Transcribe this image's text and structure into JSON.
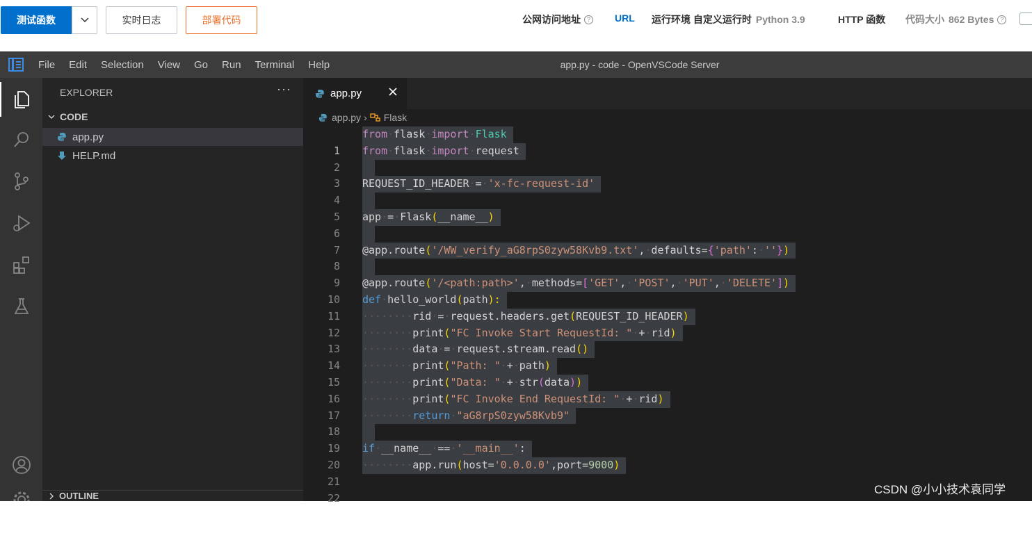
{
  "console": {
    "test_button": "测试函数",
    "log_button": "实时日志",
    "deploy_button": "部署代码",
    "public_url_label": "公网访问地址",
    "public_url_link": "URL",
    "runtime_label": "运行环境 自定义运行时",
    "runtime_value": "Python 3.9",
    "function_type": "HTTP 函数",
    "code_size_label": "代码大小",
    "code_size_value": "862 Bytes"
  },
  "vscode": {
    "window_title": "app.py - code - OpenVSCode Server",
    "menu": [
      "File",
      "Edit",
      "Selection",
      "View",
      "Go",
      "Run",
      "Terminal",
      "Help"
    ],
    "explorer": {
      "header": "EXPLORER",
      "more": "···",
      "folder": "CODE",
      "files": [
        "app.py",
        "HELP.md"
      ],
      "outline": "OUTLINE"
    },
    "tab_label": "app.py",
    "breadcrumb": {
      "file": "app.py",
      "symbol": "Flask"
    },
    "line_numbers": [
      "1",
      "2",
      "3",
      "4",
      "5",
      "6",
      "7",
      "8",
      "9",
      "10",
      "11",
      "12",
      "13",
      "14",
      "15",
      "16",
      "17",
      "18",
      "19",
      "20",
      "21",
      "22"
    ]
  },
  "code_text": {
    "l1": [
      "from",
      "flask",
      "import",
      "Flask"
    ],
    "l2": [
      "from",
      "flask",
      "import",
      "request"
    ],
    "l4": [
      "REQUEST_ID_HEADER",
      "=",
      "'x-fc-request-id'"
    ],
    "l6": [
      "app",
      "=",
      "Flask",
      "(",
      "__name__",
      ")"
    ],
    "l8": [
      "@app.route",
      "(",
      "'/WW_verify_aG8rpS0zyw58Kvb9.txt'",
      ",",
      "defaults",
      "=",
      "{",
      "'path'",
      ":",
      "''",
      "}",
      ")"
    ],
    "l10": [
      "@app.route",
      "(",
      "'/<path:path>'",
      ",",
      "methods",
      "=",
      "[",
      "'GET'",
      ",",
      "'POST'",
      ",",
      "'PUT'",
      ",",
      "'DELETE'",
      "]",
      ")"
    ],
    "l11": [
      "def",
      "hello_world",
      "(",
      "path",
      "):"
    ],
    "l12": [
      "rid",
      "=",
      "request",
      ".",
      "headers",
      ".",
      "get",
      "(",
      "REQUEST_ID_HEADER",
      ")"
    ],
    "l13": [
      "print",
      "(",
      "\"FC Invoke Start RequestId: \"",
      "+",
      "rid",
      ")"
    ],
    "l14": [
      "data",
      "=",
      "request",
      ".",
      "stream",
      ".",
      "read",
      "(",
      ")"
    ],
    "l15": [
      "print",
      "(",
      "\"Path: \"",
      "+",
      "path",
      ")"
    ],
    "l16": [
      "print",
      "(",
      "\"Data: \"",
      "+",
      "str",
      "(",
      "data",
      ")",
      ")"
    ],
    "l17": [
      "print",
      "(",
      "\"FC Invoke End RequestId: \"",
      "+",
      "rid",
      ")"
    ],
    "l18": [
      "return",
      "\"aG8rpS0zyw58Kvb9\""
    ],
    "l20": [
      "if",
      "__name__",
      "==",
      "'__main__'",
      ":"
    ],
    "l21": [
      "app",
      ".",
      "run",
      "(",
      "host",
      "=",
      "'0.0.0.0'",
      ",",
      "port",
      "=",
      "9000",
      ")"
    ]
  },
  "watermark": "CSDN @小小技术袁同学",
  "colors": {
    "primary_blue": "#0070cc",
    "deploy_orange": "#e8702a",
    "editor_bg": "#1e1e1e",
    "sidebar_bg": "#252526",
    "activity_bg": "#333333",
    "titlebar_bg": "#3c3c3c",
    "selection_bg": "#3a3d41"
  },
  "icons": {
    "activity": [
      "explorer-icon",
      "search-icon",
      "source-control-icon",
      "run-debug-icon",
      "extensions-icon",
      "testing-icon",
      "account-icon",
      "settings-gear-icon"
    ]
  }
}
